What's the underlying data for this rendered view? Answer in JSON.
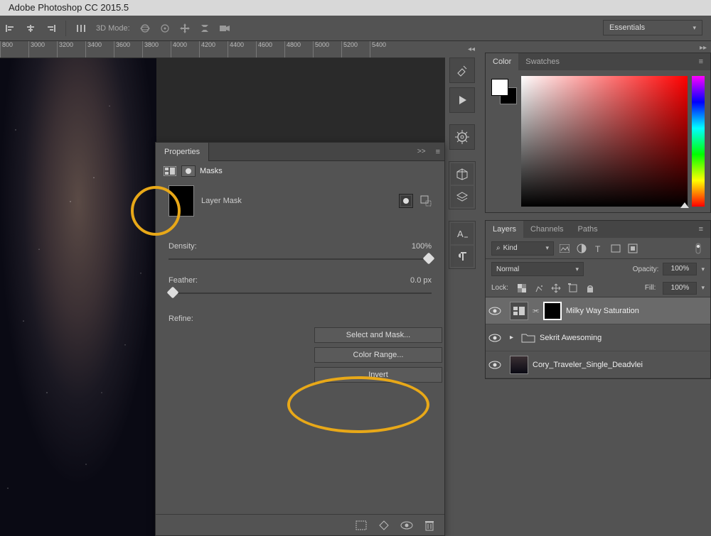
{
  "app": {
    "title": "Adobe Photoshop CC 2015.5"
  },
  "optionsbar": {
    "mode_label": "3D Mode:"
  },
  "workspace": {
    "selected": "Essentials"
  },
  "ruler_ticks": [
    "800",
    "3000",
    "3200",
    "3400",
    "3600",
    "3800",
    "4000",
    "4200",
    "4400",
    "4600",
    "4800",
    "5000",
    "5200",
    "5400"
  ],
  "properties": {
    "tab": "Properties",
    "section": "Masks",
    "mask_type": "Layer Mask",
    "density": {
      "label": "Density:",
      "value": "100%",
      "pos": 100
    },
    "feather": {
      "label": "Feather:",
      "value": "0.0 px",
      "pos": 0
    },
    "refine_label": "Refine:",
    "buttons": {
      "select_and_mask": "Select and Mask...",
      "color_range": "Color Range...",
      "invert": "Invert"
    }
  },
  "color_panel": {
    "tab_color": "Color",
    "tab_swatches": "Swatches"
  },
  "layers_panel": {
    "tab_layers": "Layers",
    "tab_channels": "Channels",
    "tab_paths": "Paths",
    "kind_label": "Kind",
    "kind_prefix": "⌕",
    "blend_mode": "Normal",
    "opacity_label": "Opacity:",
    "opacity_value": "100%",
    "lock_label": "Lock:",
    "fill_label": "Fill:",
    "fill_value": "100%",
    "layers": [
      {
        "name": "Milky Way Saturation"
      },
      {
        "name": "Sekrit Awesoming"
      },
      {
        "name": "Cory_Traveler_Single_Deadvlei"
      }
    ]
  }
}
